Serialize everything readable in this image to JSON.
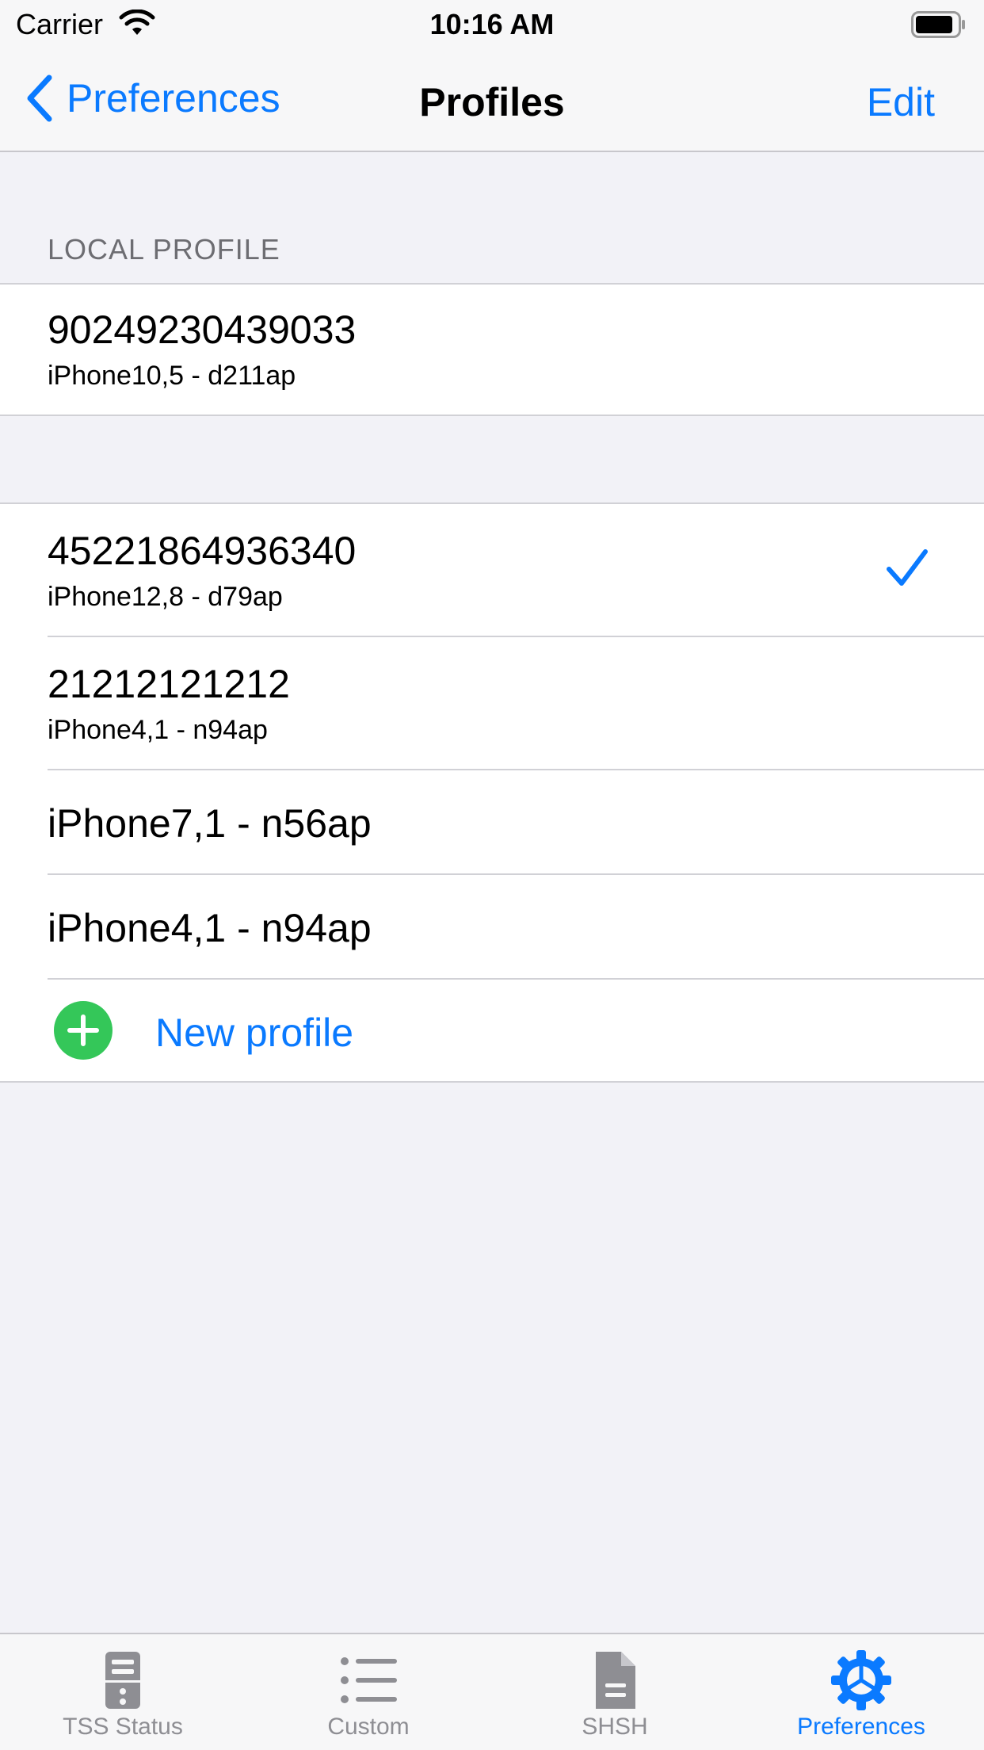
{
  "status": {
    "carrier": "Carrier",
    "time": "10:16 AM"
  },
  "nav": {
    "back_label": "Preferences",
    "title": "Profiles",
    "edit_label": "Edit"
  },
  "local_section": {
    "header": "LOCAL PROFILE",
    "profile": {
      "title": "90249230439033",
      "subtitle": "iPhone10,5 - d211ap"
    }
  },
  "profiles": [
    {
      "title": "45221864936340",
      "subtitle": "iPhone12,8 - d79ap",
      "selected": true
    },
    {
      "title": "21212121212",
      "subtitle": "iPhone4,1 - n94ap",
      "selected": false
    },
    {
      "title": "iPhone7,1 - n56ap"
    },
    {
      "title": "iPhone4,1 - n94ap"
    }
  ],
  "new_profile_label": "New profile",
  "tabs": [
    {
      "label": "TSS Status",
      "icon": "server-icon"
    },
    {
      "label": "Custom",
      "icon": "list-icon"
    },
    {
      "label": "SHSH",
      "icon": "document-icon"
    },
    {
      "label": "Preferences",
      "icon": "gear-icon",
      "active": true
    }
  ],
  "colors": {
    "accent": "#0a7aff",
    "add": "#34c759",
    "background": "#f2f2f7"
  }
}
